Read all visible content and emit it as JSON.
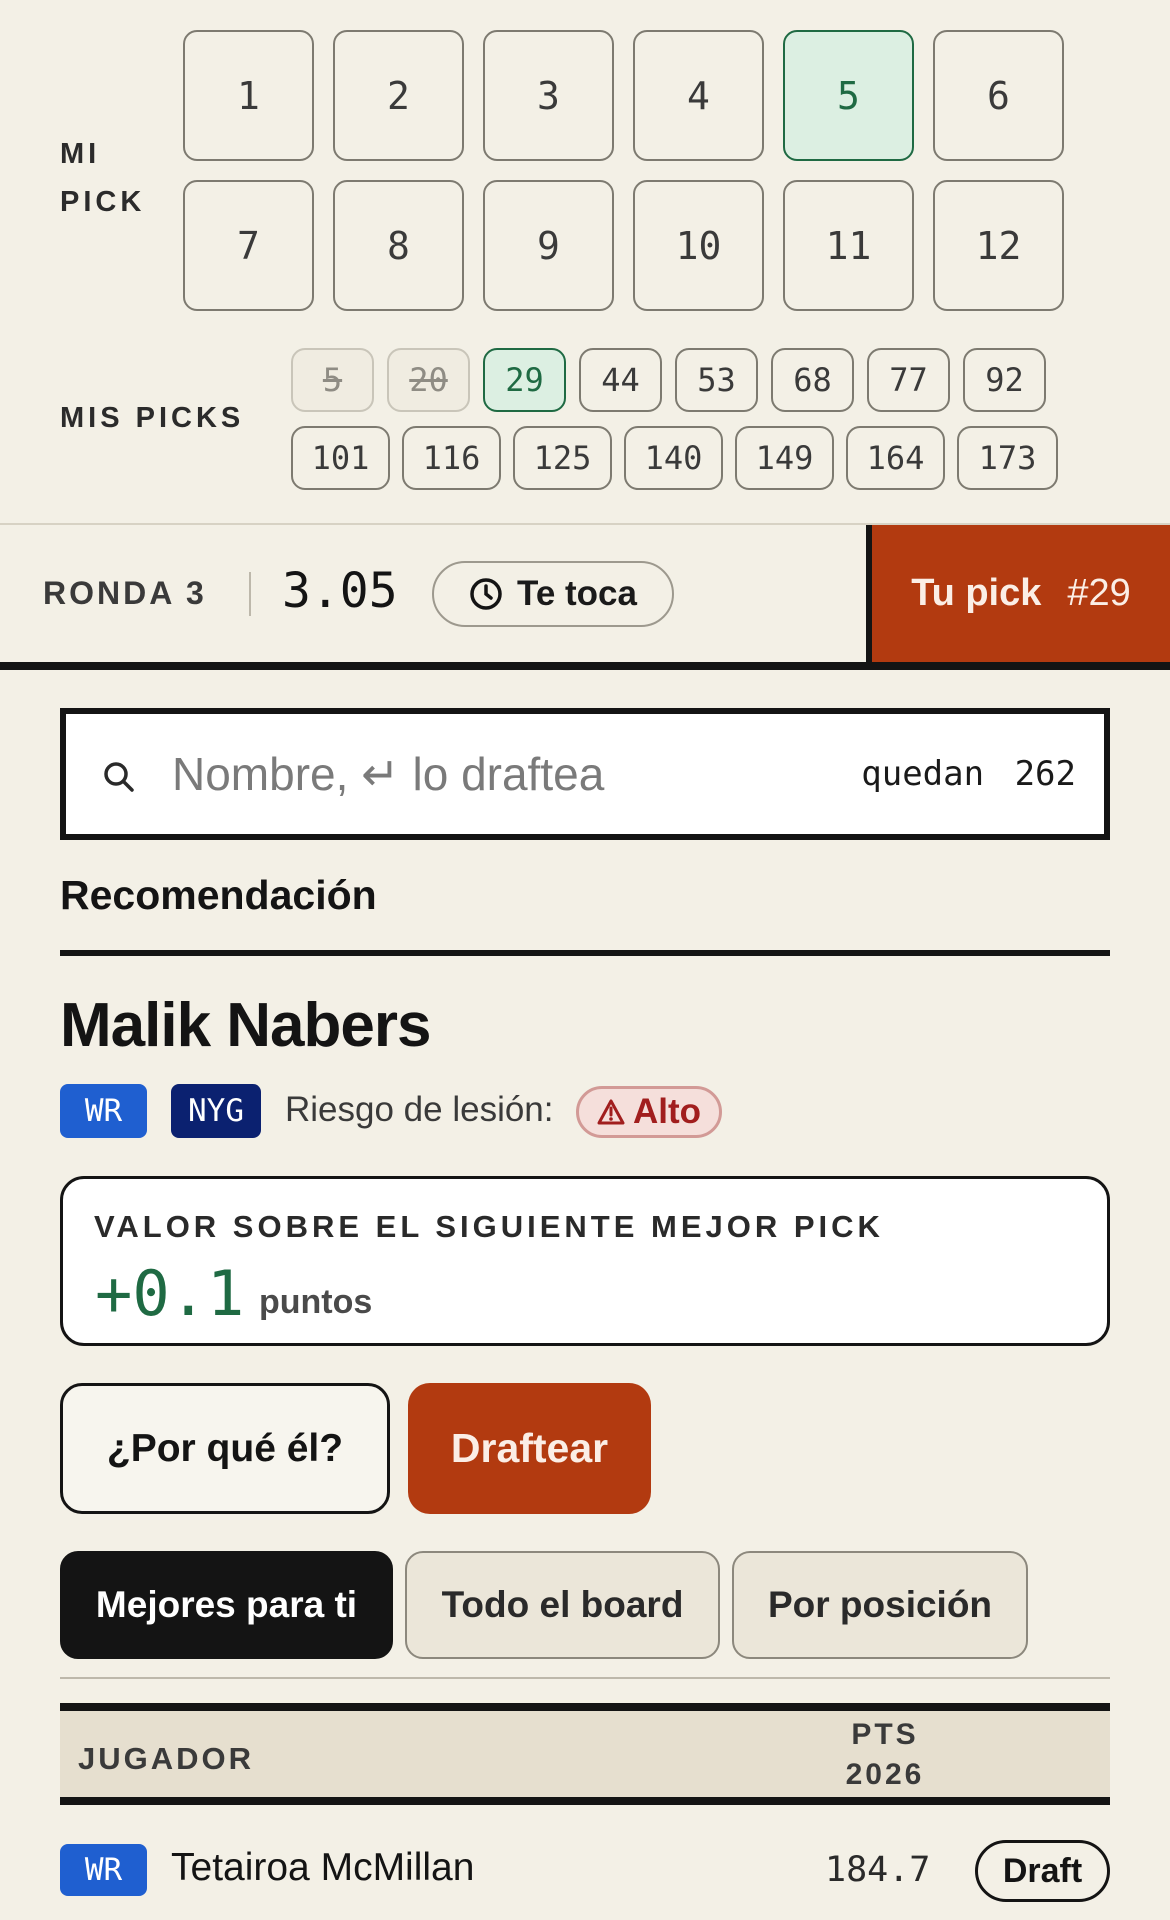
{
  "mi_pick": {
    "label_line1": "MI",
    "label_line2": "PICK",
    "slots": [
      "1",
      "2",
      "3",
      "4",
      "5",
      "6",
      "7",
      "8",
      "9",
      "10",
      "11",
      "12"
    ],
    "selected": "5"
  },
  "mis_picks": {
    "label": "MIS PICKS",
    "row1": [
      "5",
      "20",
      "29",
      "44",
      "53",
      "68",
      "77",
      "92"
    ],
    "row2": [
      "101",
      "116",
      "125",
      "140",
      "149",
      "164",
      "173"
    ],
    "used": [
      "5",
      "20"
    ],
    "current": "29"
  },
  "round": {
    "label": "RONDA 3",
    "pick_code": "3.05",
    "status": "Te toca",
    "tu_pick_label": "Tu pick",
    "tu_pick_number": "#29"
  },
  "search": {
    "placeholder": "Nombre, ↵ lo draftea",
    "remaining_label": "quedan",
    "remaining_count": "262"
  },
  "recommendation": {
    "section_title": "Recomendación",
    "player_name": "Malik Nabers",
    "position": "WR",
    "team": "NYG",
    "injury_label": "Riesgo de lesión:",
    "injury_level": "Alto",
    "value_title": "VALOR SOBRE EL SIGUIENTE MEJOR PICK",
    "value_amount": "+0.1",
    "value_unit": "puntos",
    "why_button": "¿Por qué él?",
    "draft_button": "Draftear"
  },
  "tabs": [
    "Mejores para ti",
    "Todo el board",
    "Por posición"
  ],
  "active_tab": "Mejores para ti",
  "table": {
    "col_player": "JUGADOR",
    "col_pts_line1": "PTS",
    "col_pts_line2": "2026",
    "rows": [
      {
        "position": "WR",
        "name": "Tetairoa McMillan",
        "pts": "184.7",
        "action": "Draft"
      }
    ]
  },
  "colors": {
    "background": "#f3f0e6",
    "accent": "#b23a10",
    "selected_green": "#1f6a43",
    "wr_blue": "#1f5fd0",
    "nyg_navy": "#0b2170",
    "risk_red": "#a11e1e"
  }
}
